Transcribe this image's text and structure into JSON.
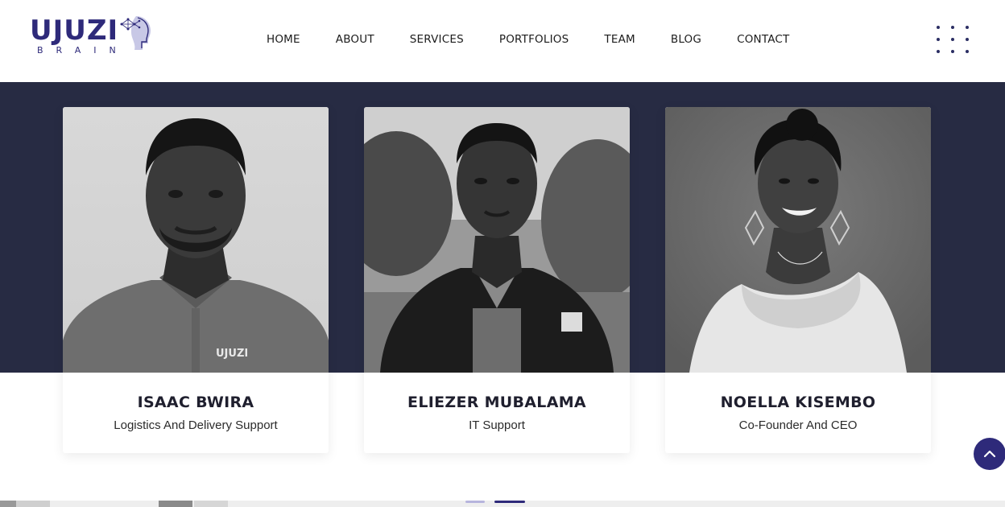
{
  "brand": {
    "name": "UJUZI",
    "subtitle": "BRAIN",
    "color": "#2e2a7a"
  },
  "nav": {
    "items": [
      {
        "label": "HOME"
      },
      {
        "label": "ABOUT"
      },
      {
        "label": "SERVICES"
      },
      {
        "label": "PORTFOLIOS"
      },
      {
        "label": "TEAM"
      },
      {
        "label": "BLOG"
      },
      {
        "label": "CONTACT"
      }
    ],
    "menu_icon": "grid-dots-icon"
  },
  "team": {
    "band_color": "#272b43",
    "members": [
      {
        "name": "ISAAC BWIRA",
        "role": "Logistics And Delivery Support",
        "photo_icon": "person-photo-icon"
      },
      {
        "name": "ELIEZER MUBALAMA",
        "role": "IT Support",
        "photo_icon": "person-photo-icon"
      },
      {
        "name": "NOELLA KISEMBO",
        "role": "Co-Founder And CEO",
        "photo_icon": "person-photo-icon"
      }
    ]
  },
  "scroll_top": {
    "icon": "chevron-up-icon"
  }
}
